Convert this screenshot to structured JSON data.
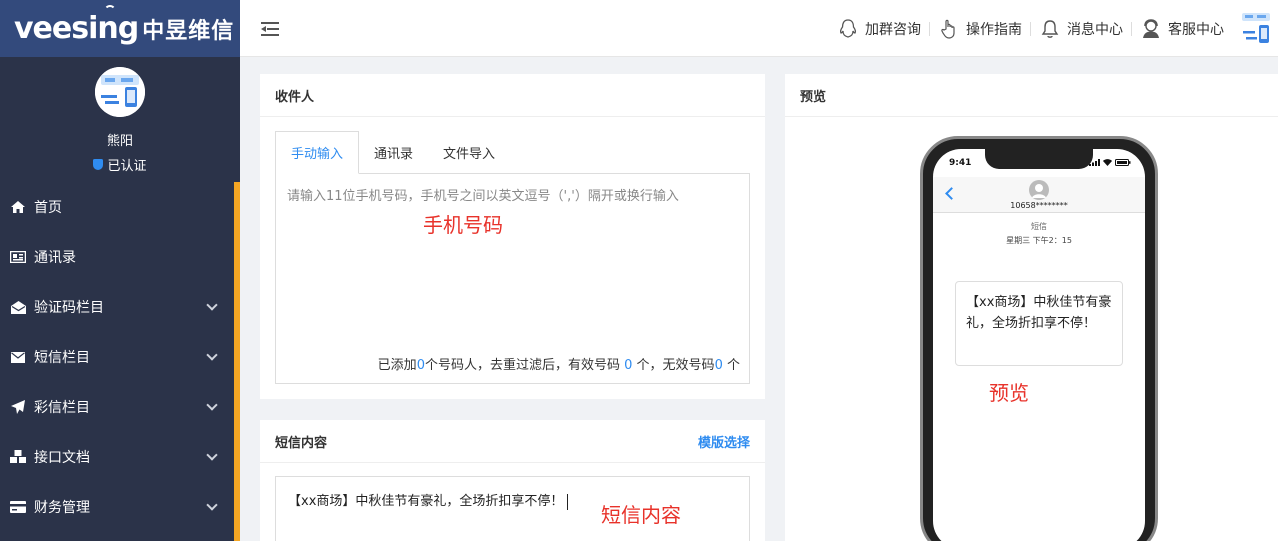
{
  "brand": {
    "logo_en": "veesing",
    "logo_cn": "中昱维信"
  },
  "profile": {
    "name": "熊阳",
    "status": "已认证"
  },
  "sidebar": {
    "items": [
      {
        "label": "首页",
        "icon": "home-icon",
        "has_children": false
      },
      {
        "label": "通讯录",
        "icon": "address-card-icon",
        "has_children": false
      },
      {
        "label": "验证码栏目",
        "icon": "envelope-open-icon",
        "has_children": true
      },
      {
        "label": "短信栏目",
        "icon": "envelope-icon",
        "has_children": true
      },
      {
        "label": "彩信栏目",
        "icon": "paper-plane-icon",
        "has_children": true
      },
      {
        "label": "接口文档",
        "icon": "cubes-icon",
        "has_children": true
      },
      {
        "label": "财务管理",
        "icon": "credit-card-icon",
        "has_children": true
      }
    ]
  },
  "header": {
    "links": [
      {
        "label": "加群咨询",
        "icon": "qq-icon"
      },
      {
        "label": "操作指南",
        "icon": "hand-pointer-icon"
      },
      {
        "label": "消息中心",
        "icon": "bell-icon"
      },
      {
        "label": "客服中心",
        "icon": "customer-service-icon"
      }
    ]
  },
  "recipients": {
    "title": "收件人",
    "tabs": [
      "手动输入",
      "通讯录",
      "文件导入"
    ],
    "active_tab": 0,
    "placeholder": "请输入11位手机号码，手机号之间以英文逗号（','）隔开或换行输入",
    "annotation": "手机号码",
    "stat_prefix": "已添加",
    "added_count": "0",
    "stat_mid1": "个号码人，去重过滤后，有效号码",
    "valid_count": "0",
    "stat_mid2": "个，无效号码",
    "invalid_count": "0",
    "stat_suffix": "个"
  },
  "sms": {
    "title": "短信内容",
    "template_link": "模版选择",
    "content": "【xx商场】中秋佳节有豪礼，全场折扣享不停！",
    "annotation": "短信内容"
  },
  "preview": {
    "title": "预览",
    "phone_time": "9:41",
    "contact_number": "10658********",
    "message_type": "短信",
    "message_time": "星期三 下午2：15",
    "bubble_text": "【xx商场】中秋佳节有豪礼，全场折扣享不停！",
    "annotation": "预览"
  },
  "colors": {
    "accent": "#2f8cf0",
    "sidebar_bg": "#2b3349",
    "logo_bg": "#334a7c",
    "scroll_accent": "#f5a623",
    "annotation": "#e8322a"
  }
}
